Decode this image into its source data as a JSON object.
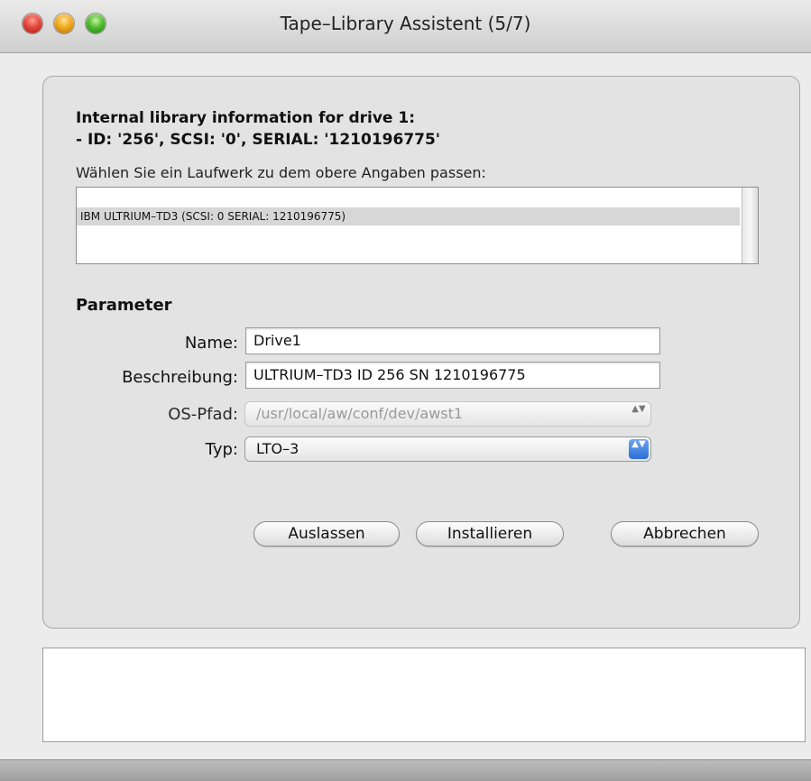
{
  "window": {
    "title": "Tape–Library Assistent (5/7)"
  },
  "info": {
    "line1": "Internal library information for drive 1:",
    "line2": "- ID: '256', SCSI: '0', SERIAL: '1210196775'",
    "prompt": "Wählen Sie ein Laufwerk zu dem obere Angaben passen:"
  },
  "drives": [
    {
      "label": "IBM ULTRIUM–TD3 (SCSI: 0 SERIAL: 1210196775)",
      "selected": true
    }
  ],
  "parameters": {
    "title": "Parameter",
    "name_label": "Name:",
    "name_value": "Drive1",
    "desc_label": "Beschreibung:",
    "desc_value": "ULTRIUM–TD3 ID 256 SN 1210196775",
    "ospath_label": "OS-Pfad:",
    "ospath_value": "/usr/local/aw/conf/dev/awst1",
    "type_label": "Typ:",
    "type_value": "LTO–3"
  },
  "buttons": {
    "skip": "Auslassen",
    "install": "Installieren",
    "cancel": "Abbrechen"
  },
  "icons": {
    "stepper": "▲▼"
  }
}
